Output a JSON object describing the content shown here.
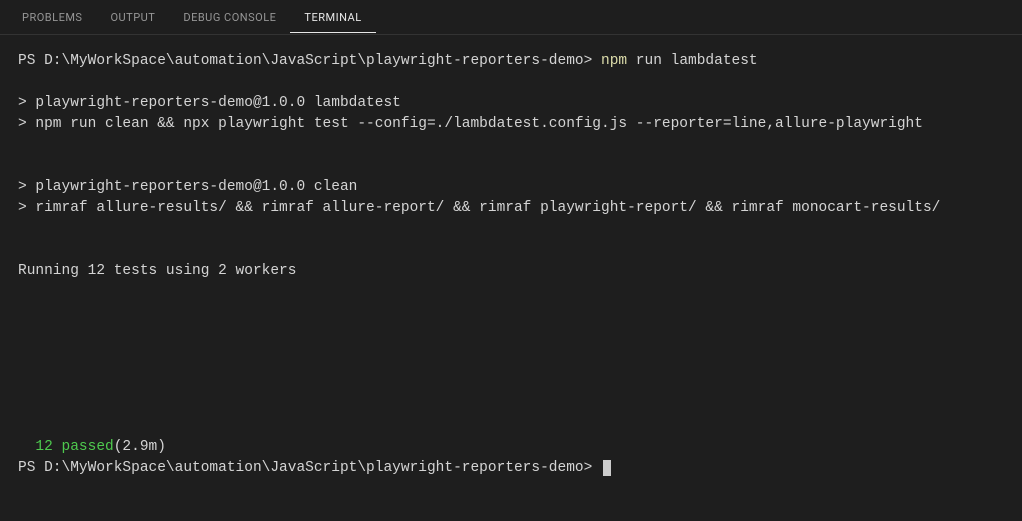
{
  "tabs": {
    "problems": "PROBLEMS",
    "output": "OUTPUT",
    "debug_console": "DEBUG CONSOLE",
    "terminal": "TERMINAL"
  },
  "terminal": {
    "prompt1_path": "PS D:\\MyWorkSpace\\automation\\JavaScript\\playwright-reporters-demo> ",
    "prompt1_cmd_npm": "npm",
    "prompt1_cmd_rest": " run lambdatest",
    "line1": "> playwright-reporters-demo@1.0.0 lambdatest",
    "line2": "> npm run clean && npx playwright test --config=./lambdatest.config.js --reporter=line,allure-playwright",
    "line3": "> playwright-reporters-demo@1.0.0 clean",
    "line4": "> rimraf allure-results/ && rimraf allure-report/ && rimraf playwright-report/ && rimraf monocart-results/",
    "running": "Running 12 tests using 2 workers",
    "result_passed": "12 passed",
    "result_duration": " (2.9m)",
    "prompt2_path": "PS D:\\MyWorkSpace\\automation\\JavaScript\\playwright-reporters-demo>"
  }
}
